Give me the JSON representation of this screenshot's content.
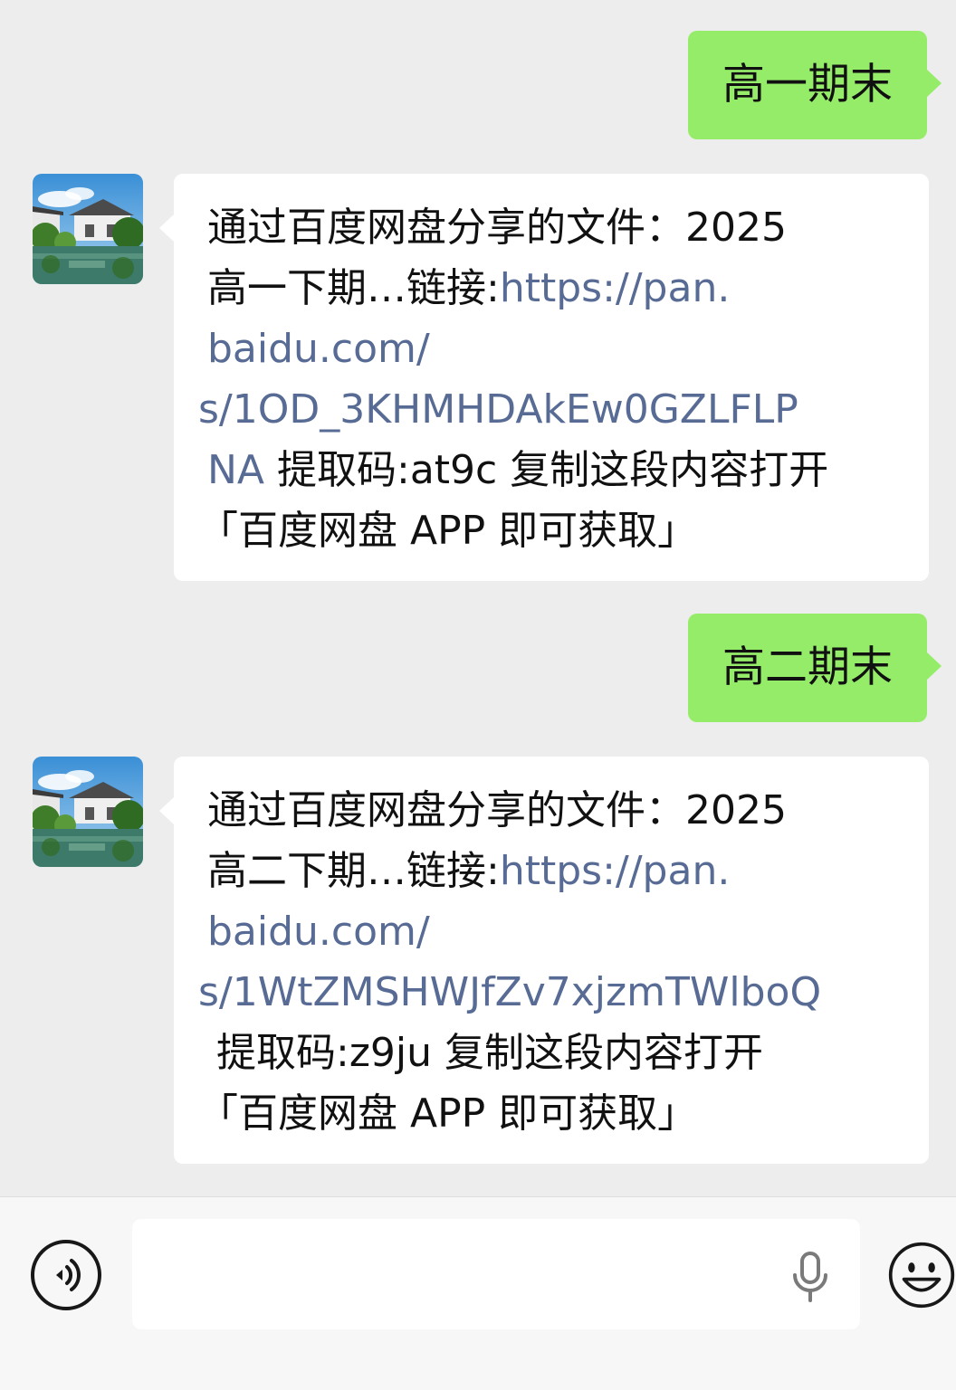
{
  "messages": [
    {
      "direction": "outgoing",
      "text": "高一期末"
    },
    {
      "direction": "incoming",
      "line1": "通过百度网盘分享的文件：2025",
      "line2_text": "高一下期…链接:",
      "line2_link": "https://pan.",
      "line3_link": "baidu.com/",
      "line4_link": "s/1OD_3KHMHDAkEw0GZLFLP",
      "line5_link": "NA",
      "line5_text": " 提取码:at9c 复制这段内容打开",
      "line6": "「百度网盘 APP 即可获取」"
    },
    {
      "direction": "outgoing",
      "text": "高二期末"
    },
    {
      "direction": "incoming",
      "line1": "通过百度网盘分享的文件：2025",
      "line2_text": "高二下期…链接:",
      "line2_link": "https://pan.",
      "line3_link": "baidu.com/",
      "line4_link": "s/1WtZMSHWJfZv7xjzmTWlboQ",
      "line5_text": "提取码:z9ju 复制这段内容打开",
      "line6": "「百度网盘 APP 即可获取」"
    }
  ],
  "input_bar": {
    "voice_icon": "voice-toggle-icon",
    "mic_icon": "microphone-icon",
    "emoji_icon": "emoji-smile-icon",
    "placeholder": ""
  },
  "colors": {
    "background": "#ededed",
    "outgoing_bubble": "#95ec69",
    "incoming_bubble": "#ffffff",
    "link": "#576b95"
  }
}
